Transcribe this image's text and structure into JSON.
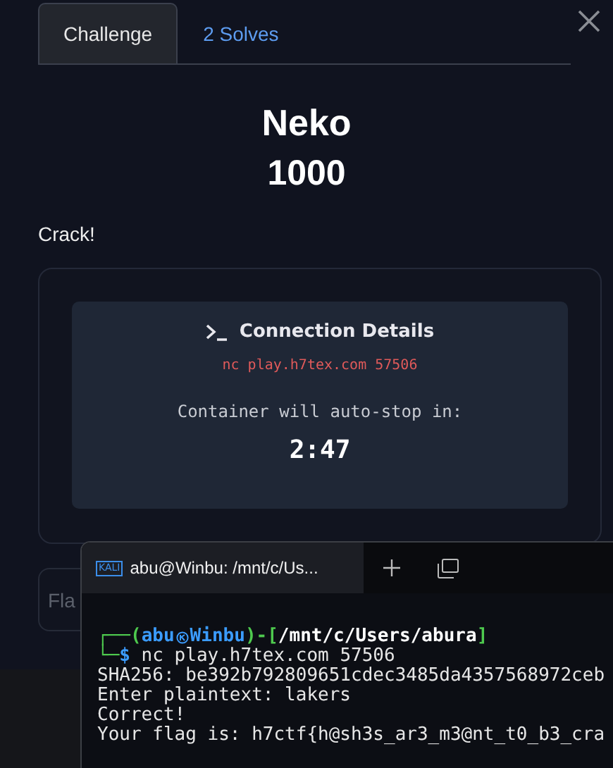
{
  "modal": {
    "tabs": [
      {
        "label": "Challenge",
        "selected": true
      },
      {
        "label": "2 Solves",
        "selected": false
      }
    ],
    "title": "Neko",
    "points": "1000",
    "description": "Crack!",
    "connection": {
      "heading": "Connection Details",
      "command": "nc play.h7tex.com 57506",
      "timer_label": "Container will auto-stop in:",
      "timer": "2:47"
    },
    "flag_field": {
      "placeholder": "Fla"
    }
  },
  "terminal": {
    "badge": "KALI",
    "tab_title": "abu@Winbu: /mnt/c/Us...",
    "prompt_lines": [
      [
        {
          "kind": "text",
          "text": "┌──(",
          "color": "#4ec94e"
        },
        {
          "kind": "text",
          "text": "abu",
          "color": "#3b9cff"
        },
        {
          "kind": "symbol",
          "color": "#3b9cff"
        },
        {
          "kind": "text",
          "text": "Winbu",
          "color": "#3b9cff"
        },
        {
          "kind": "text",
          "text": ")-[",
          "color": "#4ec94e"
        },
        {
          "kind": "text",
          "text": "/mnt/c/Users/abura",
          "color": "#ffffff"
        },
        {
          "kind": "text",
          "text": "]",
          "color": "#4ec94e"
        }
      ],
      [
        {
          "kind": "text",
          "text": "└─",
          "color": "#4ec94e"
        },
        {
          "kind": "text",
          "text": "$",
          "color": "#3b9cff"
        },
        {
          "kind": "text",
          "text": " nc play.h7tex.com 57506",
          "color": "#e6e6e6"
        }
      ]
    ],
    "output": [
      "SHA256: be392b792809651cdec3485da4357568972ceb",
      "Enter plaintext: lakers",
      "Correct!",
      "Your flag is: h7ctf{h@sh3s_ar3_m3@nt_t0_b3_cra"
    ]
  }
}
